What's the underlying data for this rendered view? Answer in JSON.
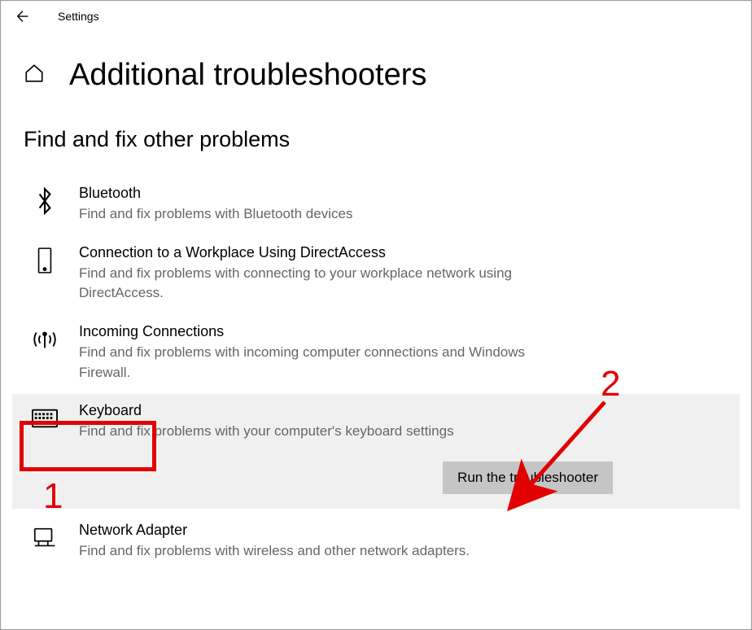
{
  "app_name": "Settings",
  "page_title": "Additional troubleshooters",
  "section_subtitle": "Find and fix other problems",
  "troubleshooters": [
    {
      "id": "bluetooth",
      "title": "Bluetooth",
      "description": "Find and fix problems with Bluetooth devices"
    },
    {
      "id": "directaccess",
      "title": "Connection to a Workplace Using DirectAccess",
      "description": "Find and fix problems with connecting to your workplace network using DirectAccess."
    },
    {
      "id": "incoming",
      "title": "Incoming Connections",
      "description": "Find and fix problems with incoming computer connections and Windows Firewall."
    },
    {
      "id": "keyboard",
      "title": "Keyboard",
      "description": "Find and fix problems with your computer's keyboard settings",
      "selected": true
    },
    {
      "id": "network",
      "title": "Network Adapter",
      "description": "Find and fix problems with wireless and other network adapters."
    }
  ],
  "run_button_label": "Run the troubleshooter",
  "annotations": {
    "number_1": "1",
    "number_2": "2"
  }
}
